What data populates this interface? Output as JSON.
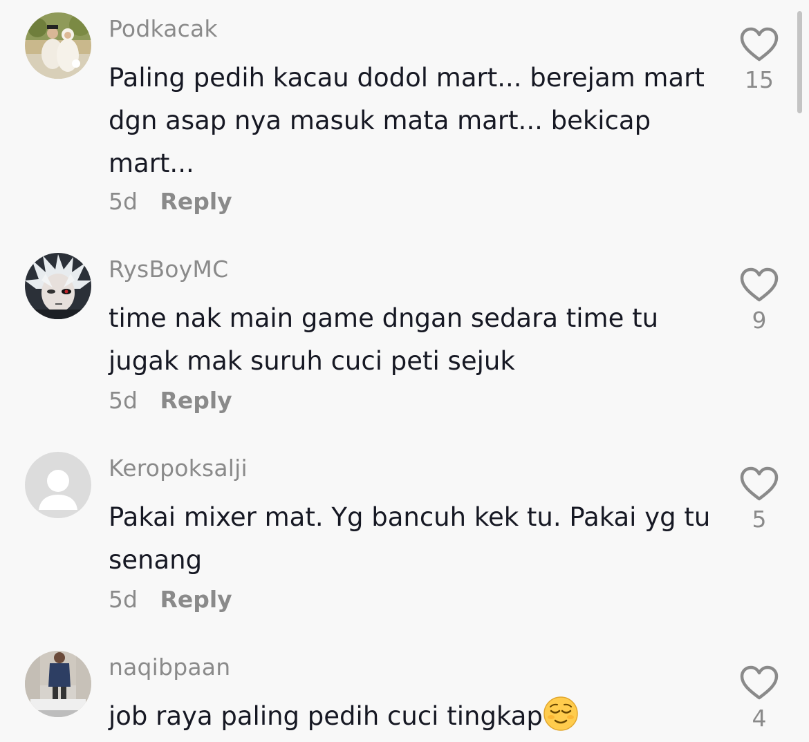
{
  "comments": [
    {
      "username": "Podkacak",
      "text": "Paling pedih kacau dodol mart... berejam mart dgn asap nya masuk mata mart... bekicap mart...",
      "time": "5d",
      "reply_label": "Reply",
      "likes": "15"
    },
    {
      "username": "RysBoyMC",
      "text": "time nak main game dngan sedara time tu jugak mak suruh cuci peti sejuk",
      "time": "5d",
      "reply_label": "Reply",
      "likes": "9"
    },
    {
      "username": "Keropoksalji",
      "text": "Pakai mixer mat. Yg bancuh kek tu. Pakai yg tu senang",
      "time": "5d",
      "reply_label": "Reply",
      "likes": "5"
    },
    {
      "username": "naqibpaan",
      "text": "job raya paling pedih cuci tingkap",
      "emoji": "relieved-face-emoji",
      "likes": "4"
    }
  ],
  "icons": {
    "like": "heart-outline-icon",
    "default_avatar": "default-user-avatar-icon"
  },
  "colors": {
    "background": "#f8f8f8",
    "text_primary": "#161823",
    "text_secondary": "#8a8a8a",
    "default_avatar": "#dcdcdc"
  }
}
